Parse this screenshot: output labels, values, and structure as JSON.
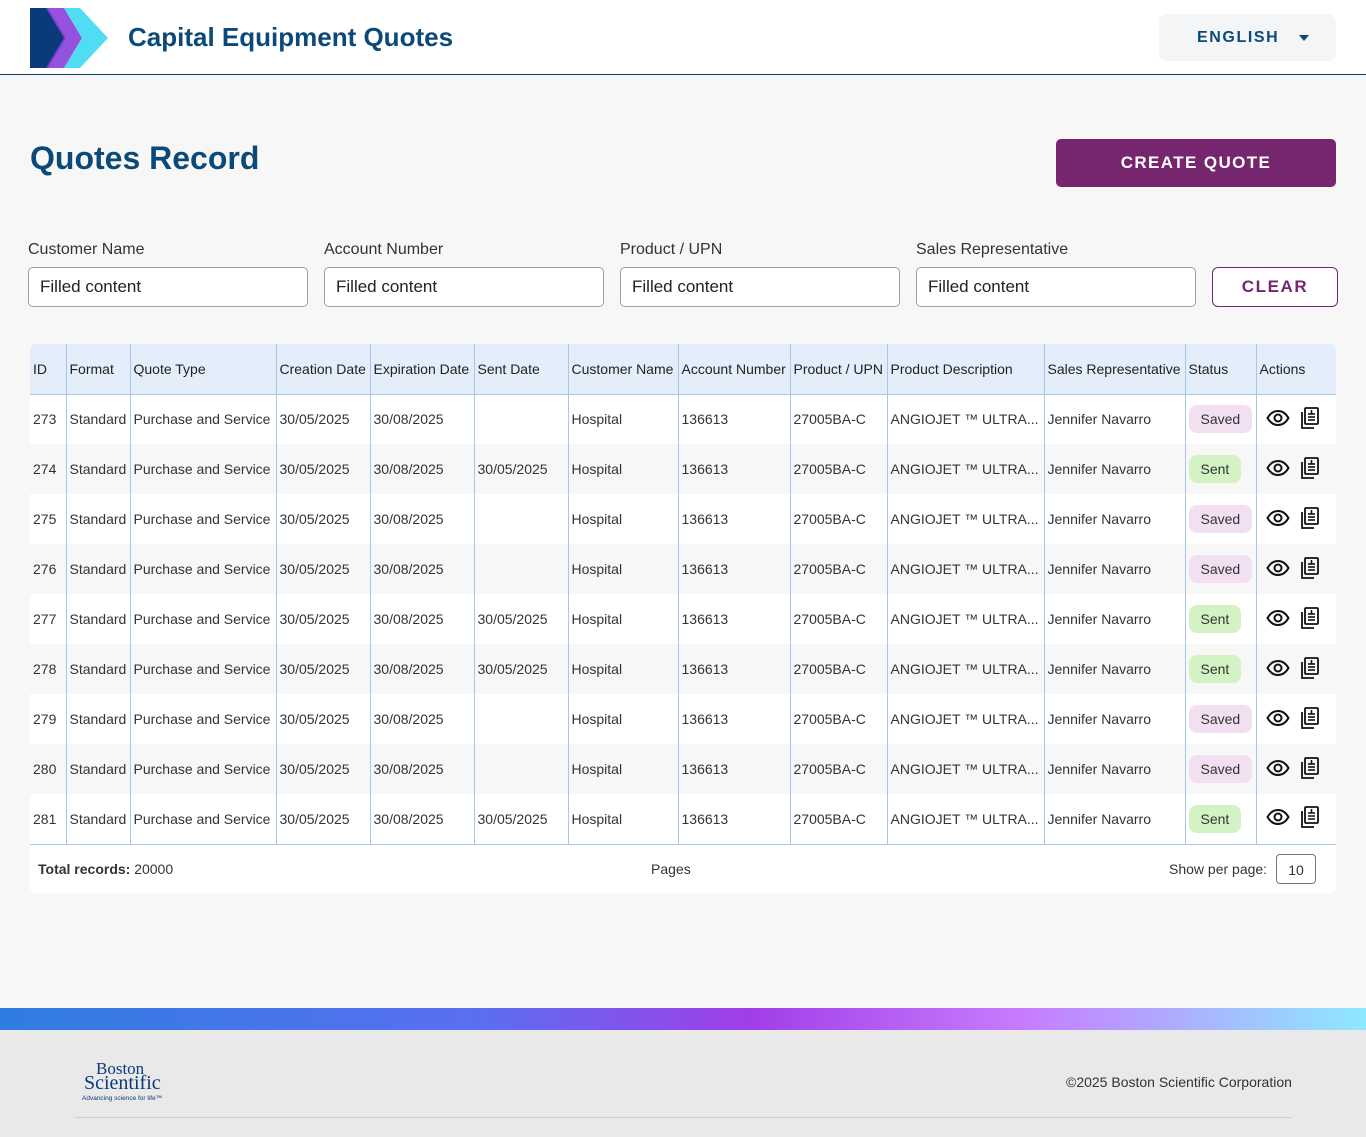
{
  "header": {
    "app_title": "Capital Equipment Quotes",
    "language": "ENGLISH"
  },
  "page": {
    "title": "Quotes Record",
    "create_label": "CREATE QUOTE"
  },
  "filters": {
    "customer": {
      "label": "Customer Name",
      "value": "Filled content"
    },
    "account": {
      "label": "Account Number",
      "value": "Filled content"
    },
    "product": {
      "label": "Product / UPN",
      "value": "Filled content"
    },
    "sales_rep": {
      "label": "Sales Representative",
      "value": "Filled content"
    },
    "clear_label": "CLEAR"
  },
  "table": {
    "columns": [
      "ID",
      "Format",
      "Quote Type",
      "Creation Date",
      "Expiration Date",
      "Sent Date",
      "Customer Name",
      "Account Number",
      "Product / UPN",
      "Product Description",
      "Sales Representative",
      "Status",
      "Actions"
    ],
    "rows": [
      [
        "273",
        "Standard",
        "Purchase and Service",
        "30/05/2025",
        "30/08/2025",
        "",
        "Hospital",
        "136613",
        "27005BA-C",
        "ANGIOJET ™ ULTRA...",
        "Jennifer Navarro",
        "Saved"
      ],
      [
        "274",
        "Standard",
        "Purchase and Service",
        "30/05/2025",
        "30/08/2025",
        "30/05/2025",
        "Hospital",
        "136613",
        "27005BA-C",
        "ANGIOJET ™ ULTRA...",
        "Jennifer Navarro",
        "Sent"
      ],
      [
        "275",
        "Standard",
        "Purchase and Service",
        "30/05/2025",
        "30/08/2025",
        "",
        "Hospital",
        "136613",
        "27005BA-C",
        "ANGIOJET ™ ULTRA...",
        "Jennifer Navarro",
        "Saved"
      ],
      [
        "276",
        "Standard",
        "Purchase and Service",
        "30/05/2025",
        "30/08/2025",
        "",
        "Hospital",
        "136613",
        "27005BA-C",
        "ANGIOJET ™ ULTRA...",
        "Jennifer Navarro",
        "Saved"
      ],
      [
        "277",
        "Standard",
        "Purchase and Service",
        "30/05/2025",
        "30/08/2025",
        "30/05/2025",
        "Hospital",
        "136613",
        "27005BA-C",
        "ANGIOJET ™ ULTRA...",
        "Jennifer Navarro",
        "Sent"
      ],
      [
        "278",
        "Standard",
        "Purchase and Service",
        "30/05/2025",
        "30/08/2025",
        "30/05/2025",
        "Hospital",
        "136613",
        "27005BA-C",
        "ANGIOJET ™ ULTRA...",
        "Jennifer Navarro",
        "Sent"
      ],
      [
        "279",
        "Standard",
        "Purchase and Service",
        "30/05/2025",
        "30/08/2025",
        "",
        "Hospital",
        "136613",
        "27005BA-C",
        "ANGIOJET ™ ULTRA...",
        "Jennifer Navarro",
        "Saved"
      ],
      [
        "280",
        "Standard",
        "Purchase and Service",
        "30/05/2025",
        "30/08/2025",
        "",
        "Hospital",
        "136613",
        "27005BA-C",
        "ANGIOJET ™ ULTRA...",
        "Jennifer Navarro",
        "Saved"
      ],
      [
        "281",
        "Standard",
        "Purchase and Service",
        "30/05/2025",
        "30/08/2025",
        "30/05/2025",
        "Hospital",
        "136613",
        "27005BA-C",
        "ANGIOJET ™ ULTRA...",
        "Jennifer Navarro",
        "Sent"
      ]
    ],
    "action_icons": [
      "eye-icon",
      "document-icon"
    ]
  },
  "pagination": {
    "total_label": "Total records:",
    "total_value": " 20000",
    "pages_label": "Pages",
    "per_page_label": "Show per page:",
    "per_page_value": "10"
  },
  "footer": {
    "logo_line1": "Boston",
    "logo_line2": "Scientific",
    "logo_tagline": "Advancing science for life™",
    "copyright": "©2025 Boston Scientific Corporation"
  },
  "colors": {
    "brand_blue": "#0b4a78",
    "brand_purple": "#76266f",
    "saved_badge": "#f3dff2",
    "sent_badge": "#d4f3c4",
    "header_row": "#e4eefb"
  }
}
